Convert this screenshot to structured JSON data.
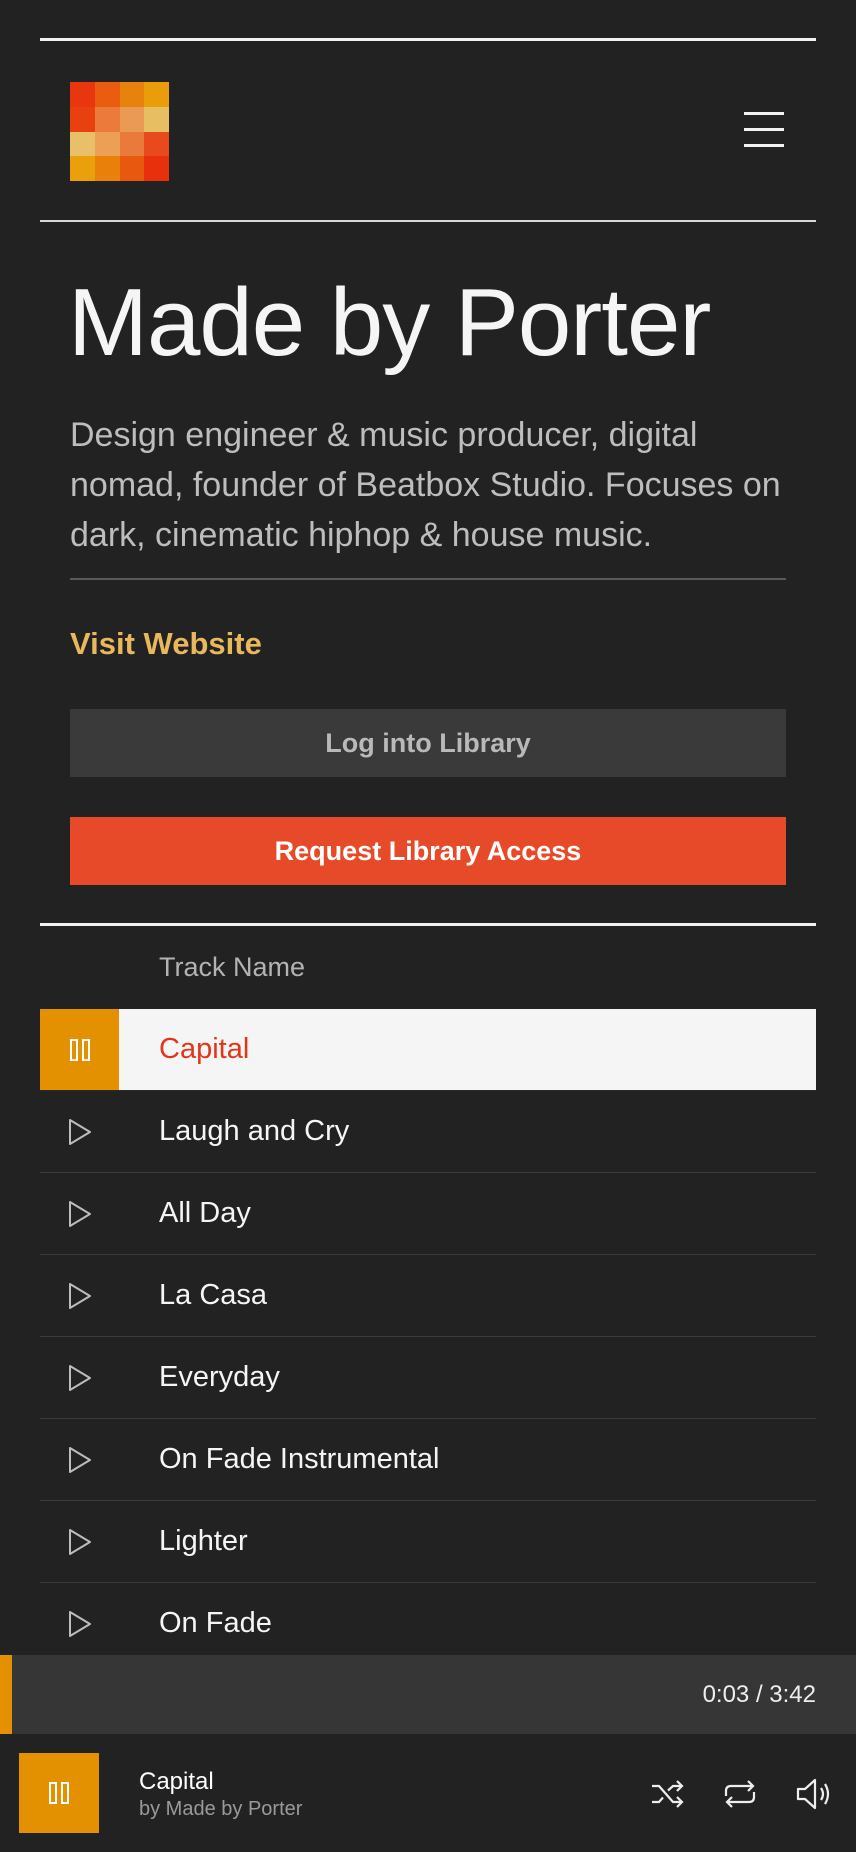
{
  "artist": {
    "name": "Made by Porter",
    "bio": "Design engineer & music producer, digital nomad, founder of Beatbox Studio. Focuses on dark, cinematic hiphop & house music.",
    "website_label": "Visit Website"
  },
  "header": {
    "logo_icon": "pixel-grid-logo-icon",
    "menu_icon": "hamburger-menu-icon"
  },
  "logo_colors": [
    "#e8360f",
    "#ea5c10",
    "#e8820e",
    "#e99d0a",
    "#e8400f",
    "#ec7a3a",
    "#ea9a55",
    "#e8be62",
    "#e8c06a",
    "#eba055",
    "#ea7a3c",
    "#e84a1e",
    "#e9a00a",
    "#e8800a",
    "#e8580e",
    "#e8300c"
  ],
  "actions": {
    "login_label": "Log into Library",
    "request_label": "Request Library Access"
  },
  "tracklist": {
    "column_header": "Track Name",
    "tracks": [
      {
        "name": "Capital",
        "state": "playing"
      },
      {
        "name": "Laugh and Cry",
        "state": "idle"
      },
      {
        "name": "All Day",
        "state": "idle"
      },
      {
        "name": "La Casa",
        "state": "idle"
      },
      {
        "name": "Everyday",
        "state": "idle"
      },
      {
        "name": "On Fade Instrumental",
        "state": "idle"
      },
      {
        "name": "Lighter",
        "state": "idle"
      },
      {
        "name": "On Fade",
        "state": "idle"
      }
    ]
  },
  "playback": {
    "time_display": "0:03 / 3:42",
    "progress_fraction": 0.014
  },
  "now_playing": {
    "title": "Capital",
    "artist": "by Made by Porter",
    "controls": [
      "shuffle-icon",
      "repeat-icon",
      "volume-icon"
    ]
  },
  "colors": {
    "background": "#222222",
    "accent_orange": "#e39100",
    "accent_red": "#e64a28",
    "link_gold": "#e9b85c"
  }
}
